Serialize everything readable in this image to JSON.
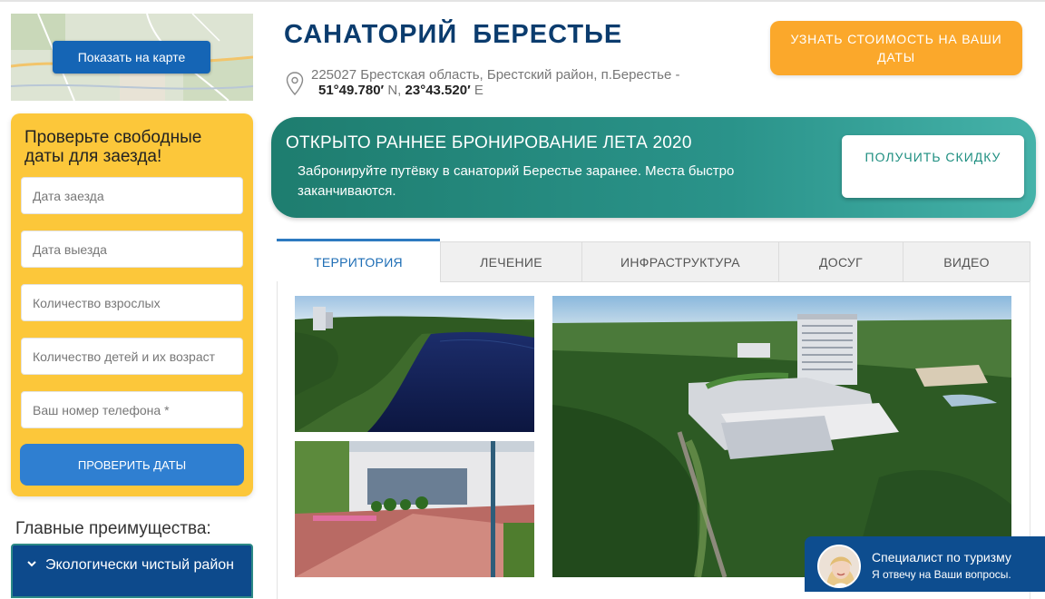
{
  "map": {
    "button_label": "Показать на карте"
  },
  "booking": {
    "title": "Проверьте свободные даты для заезда!",
    "fields": [
      {
        "placeholder": "Дата заезда"
      },
      {
        "placeholder": "Дата выезда"
      },
      {
        "placeholder": "Количество взрослых"
      },
      {
        "placeholder": "Количество детей и их возраст"
      },
      {
        "placeholder": "Ваш номер телефона *"
      }
    ],
    "submit_label": "ПРОВЕРИТЬ ДАТЫ"
  },
  "advantages": {
    "title": "Главные преимущества:",
    "items": [
      {
        "label": "Экологически чистый район",
        "icon": "chevron-down-icon"
      }
    ]
  },
  "header": {
    "title": "САНАТОРИЙ  БЕРЕСТЬЕ",
    "address": "225027 Брестская область, Брестский район, п.Берестье -",
    "lat": "51°49.780′",
    "lat_dir": " N, ",
    "lon": "23°43.520′",
    "lon_dir": " E",
    "price_button": "УЗНАТЬ СТОИМОСТЬ НА ВАШИ ДАТЫ",
    "pin_icon": "location-pin-icon"
  },
  "promo": {
    "title": "ОТКРЫТО РАННЕЕ БРОНИРОВАНИЕ ЛЕТА 2020",
    "text": "Забронируйте путёвку в санаторий Берестье заранее. Места быстро заканчиваются.",
    "button": "ПОЛУЧИТЬ СКИДКУ"
  },
  "tabs": [
    {
      "label": "ТЕРРИТОРИЯ",
      "active": true
    },
    {
      "label": "ЛЕЧЕНИЕ"
    },
    {
      "label": "ИНФРАСТРУКТУРА"
    },
    {
      "label": "ДОСУГ"
    },
    {
      "label": "ВИДЕО"
    }
  ],
  "chat": {
    "title": "Специалист по туризму",
    "subtitle": "Я отвечу на Ваши вопросы."
  },
  "colors": {
    "brand_blue": "#0b3c6e",
    "booking_yellow": "#fcc73a",
    "price_orange": "#fba82b",
    "promo_teal": "#2a938a",
    "button_blue": "#2f7fd1"
  }
}
